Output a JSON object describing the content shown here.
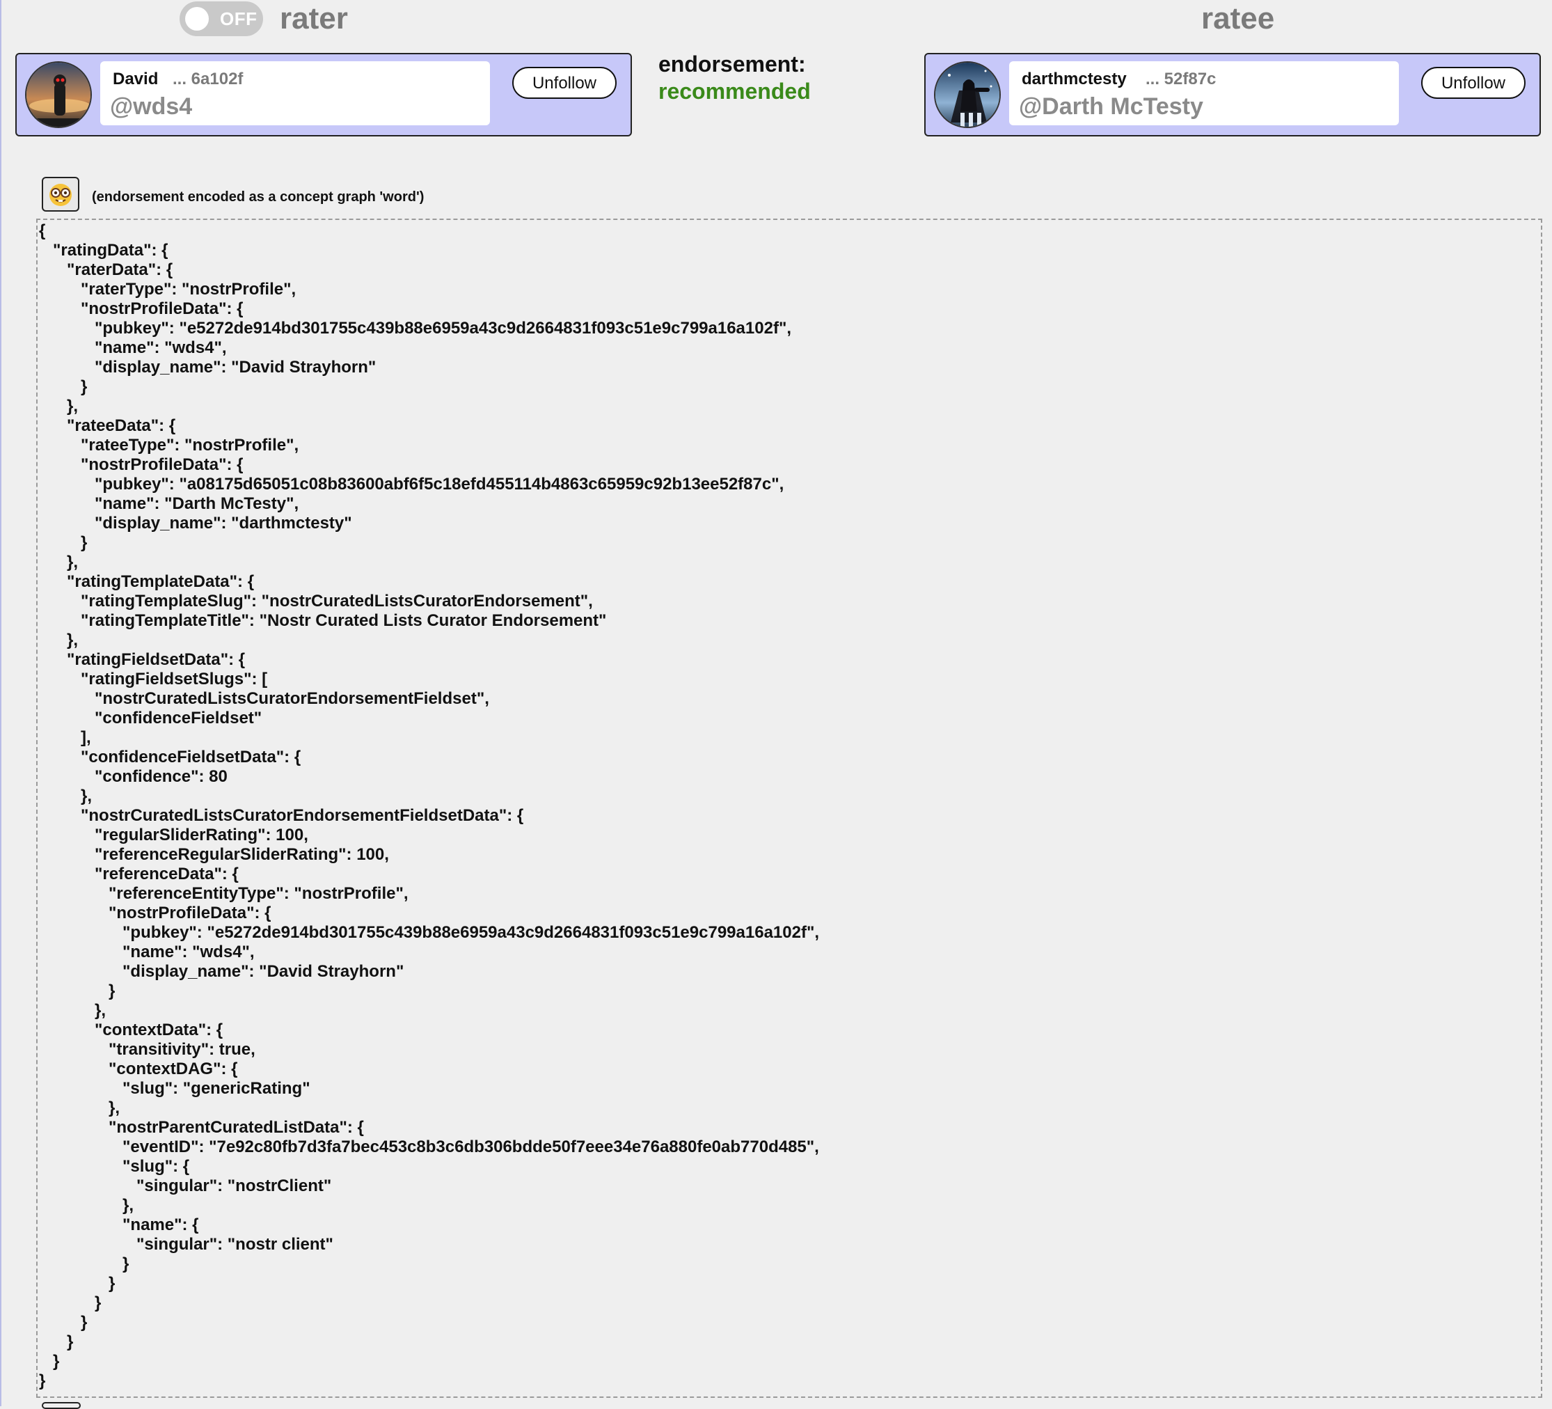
{
  "toggle": {
    "label": "OFF"
  },
  "rater": {
    "heading": "rater",
    "name": "David",
    "pubkey_short": "... 6a102f",
    "handle": "@wds4",
    "button": "Unfollow"
  },
  "ratee": {
    "heading": "ratee",
    "name": "darthmctesty",
    "pubkey_short": "... 52f87c",
    "handle": "@Darth McTesty",
    "button": "Unfollow"
  },
  "endorsement": {
    "label": "endorsement:",
    "value": "recommended"
  },
  "concept": {
    "icon": "nerd-face-icon",
    "caption": "(endorsement encoded as a concept graph 'word')"
  },
  "json_text": "{\n   \"ratingData\": {\n      \"raterData\": {\n         \"raterType\": \"nostrProfile\",\n         \"nostrProfileData\": {\n            \"pubkey\": \"e5272de914bd301755c439b88e6959a43c9d2664831f093c51e9c799a16a102f\",\n            \"name\": \"wds4\",\n            \"display_name\": \"David Strayhorn\"\n         }\n      },\n      \"rateeData\": {\n         \"rateeType\": \"nostrProfile\",\n         \"nostrProfileData\": {\n            \"pubkey\": \"a08175d65051c08b83600abf6f5c18efd455114b4863c65959c92b13ee52f87c\",\n            \"name\": \"Darth McTesty\",\n            \"display_name\": \"darthmctesty\"\n         }\n      },\n      \"ratingTemplateData\": {\n         \"ratingTemplateSlug\": \"nostrCuratedListsCuratorEndorsement\",\n         \"ratingTemplateTitle\": \"Nostr Curated Lists Curator Endorsement\"\n      },\n      \"ratingFieldsetData\": {\n         \"ratingFieldsetSlugs\": [\n            \"nostrCuratedListsCuratorEndorsementFieldset\",\n            \"confidenceFieldset\"\n         ],\n         \"confidenceFieldsetData\": {\n            \"confidence\": 80\n         },\n         \"nostrCuratedListsCuratorEndorsementFieldsetData\": {\n            \"regularSliderRating\": 100,\n            \"referenceRegularSliderRating\": 100,\n            \"referenceData\": {\n               \"referenceEntityType\": \"nostrProfile\",\n               \"nostrProfileData\": {\n                  \"pubkey\": \"e5272de914bd301755c439b88e6959a43c9d2664831f093c51e9c799a16a102f\",\n                  \"name\": \"wds4\",\n                  \"display_name\": \"David Strayhorn\"\n               }\n            },\n            \"contextData\": {\n               \"transitivity\": true,\n               \"contextDAG\": {\n                  \"slug\": \"genericRating\"\n               },\n               \"nostrParentCuratedListData\": {\n                  \"eventID\": \"7e92c80fb7d3fa7bec453c8b3c6db306bdde50f7eee34e76a880fe0ab770d485\",\n                  \"slug\": {\n                     \"singular\": \"nostrClient\"\n                  },\n                  \"name\": {\n                     \"singular\": \"nostr client\"\n                  }\n               }\n            }\n         }\n      }\n   }\n}"
}
